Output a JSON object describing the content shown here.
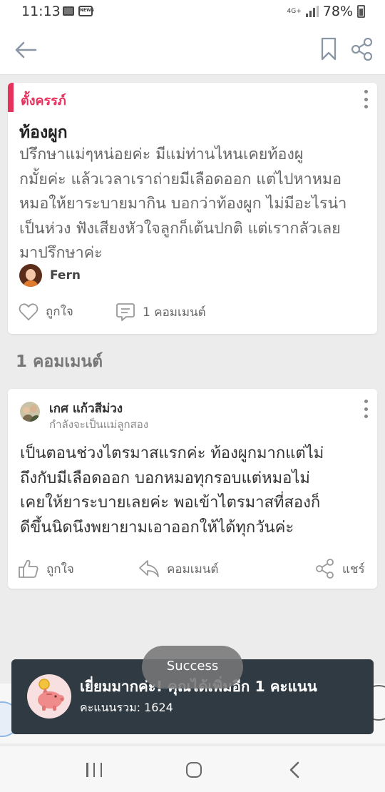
{
  "status_bar": {
    "time": "11:13",
    "network": "4G+",
    "battery": "78%",
    "notif_label": "NEWS"
  },
  "post": {
    "category": "ตั้งครรภ์",
    "title": "ท้องผูก",
    "body_lines": [
      "ปรึกษาแม่ๆหน่อยค่ะ มีแม่ท่านไหนเคยท้องผู",
      "กมั้ยค่ะ แล้วเวลาเราถ่ายมีเลือดออก แต่ไปหาหมอ",
      "หมอให้ยาระบายมากิน บอกว่าท้องผูก ไม่มีอะไรน่า",
      "เป็นห่วง ฟังเสียงหัวใจลูกก็เต้นปกติ แต่เรากลัวเลย",
      "มาปรึกษาค่ะ"
    ],
    "author": "Fern",
    "like_label": "ถูกใจ",
    "comment_label": "1 คอมเมนต์"
  },
  "comments_section": {
    "title": "1 คอมเมนต์"
  },
  "comment": {
    "author": "เกศ แก้วสีม่วง",
    "status": "กำลังจะเป็นแม่ลูกสอง",
    "body_lines": [
      "เป็นตอนช่วงไตรมาสแรกค่ะ ท้องผูกมากแต่ไม่",
      "ถึงกับมีเลือดออก บอกหมอทุกรอบแต่หมอไม่",
      "เคยให้ยาระบายเลยค่ะ พอเข้าไตรมาสที่สองก็",
      "ดีขึ้นนิดนึงพยายามเอาออกให้ได้ทุกวันค่ะ"
    ],
    "like_label": "ถูกใจ",
    "reply_label": "คอมเมนต์",
    "share_label": "แชร์"
  },
  "snackbar": {
    "title": "เยี่ยมมากค่ะ! คุณได้เพิ่มอีก 1 คะแนน",
    "subtitle": "คะแนนรวม: 1624"
  },
  "toast": {
    "text": "Success"
  },
  "colors": {
    "accent": "#e8305d",
    "snackbar_bg": "#2f3a43"
  }
}
